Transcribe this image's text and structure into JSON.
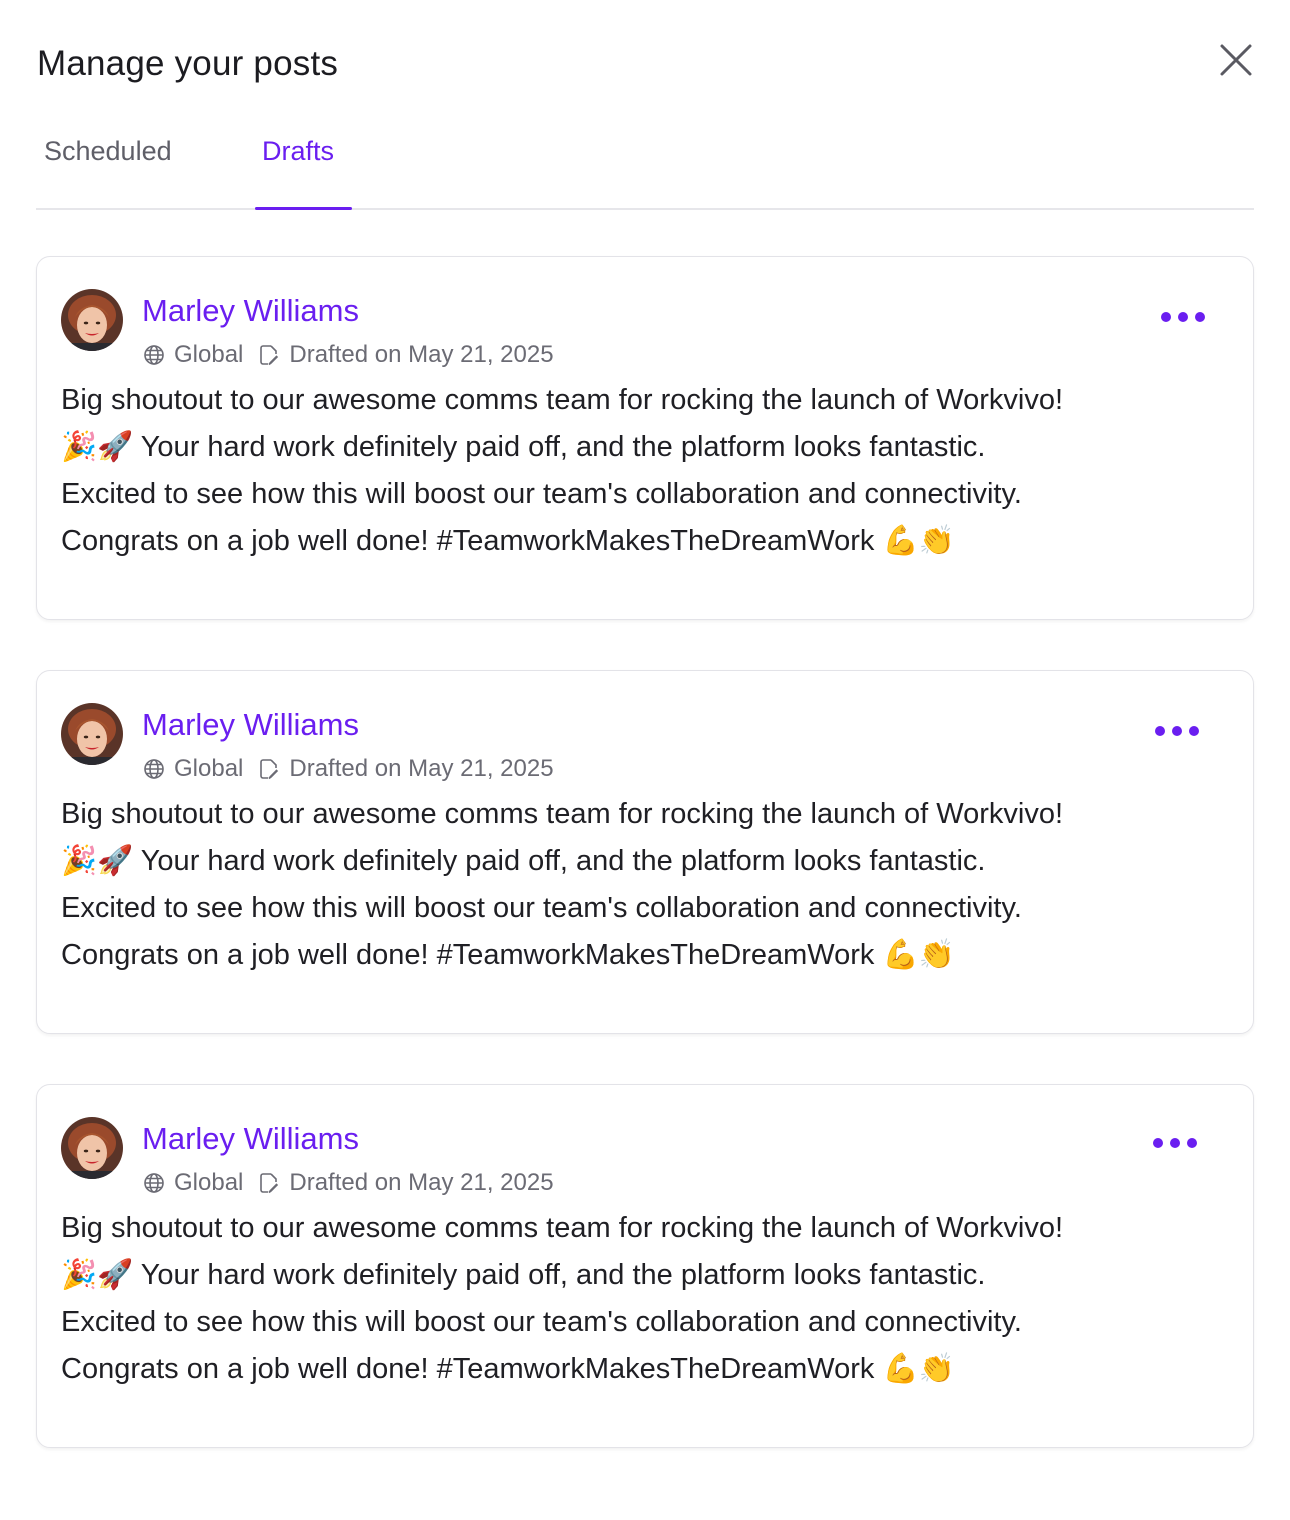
{
  "header": {
    "title": "Manage your posts",
    "close_icon": "close-icon"
  },
  "tabs": [
    {
      "label": "Scheduled",
      "active": false
    },
    {
      "label": "Drafts",
      "active": true
    }
  ],
  "colors": {
    "accent": "#6a1ef0",
    "text": "#1f1f24",
    "muted": "#6b6b74",
    "border": "#e3e3e8"
  },
  "posts": [
    {
      "author": "Marley Williams",
      "audience": "Global",
      "drafted": "Drafted on May 21, 2025",
      "lines": [
        "Big shoutout to our awesome comms team for rocking the launch of Workvivo!",
        "🎉🚀 Your hard work definitely paid off, and the platform looks fantastic.",
        "Excited to see how this will boost our team's collaboration and connectivity.",
        "Congrats on a job well done! #TeamworkMakesTheDreamWork 💪👏"
      ]
    },
    {
      "author": "Marley Williams",
      "audience": "Global",
      "drafted": "Drafted on May 21, 2025",
      "lines": [
        "Big shoutout to our awesome comms team for rocking the launch of Workvivo!",
        "🎉🚀 Your hard work definitely paid off, and the platform looks fantastic.",
        "Excited to see how this will boost our team's collaboration and connectivity.",
        "Congrats on a job well done! #TeamworkMakesTheDreamWork 💪👏"
      ]
    },
    {
      "author": "Marley Williams",
      "audience": "Global",
      "drafted": "Drafted on May 21, 2025",
      "lines": [
        "Big shoutout to our awesome comms team for rocking the launch of Workvivo!",
        "🎉🚀 Your hard work definitely paid off, and the platform looks fantastic.",
        "Excited to see how this will boost our team's collaboration and connectivity.",
        "Congrats on a job well done! #TeamworkMakesTheDreamWork 💪👏"
      ]
    }
  ]
}
